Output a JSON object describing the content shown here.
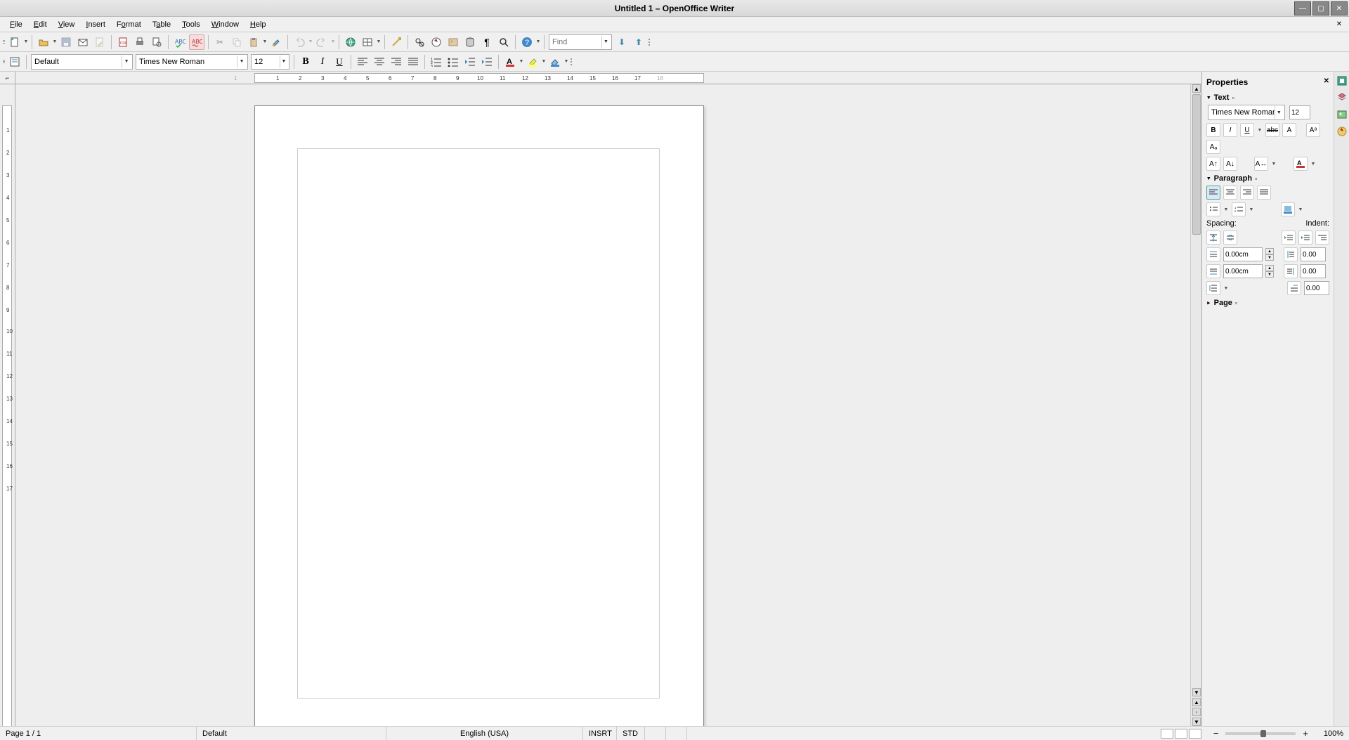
{
  "title": "Untitled 1 – OpenOffice Writer",
  "menu": {
    "items": [
      "File",
      "Edit",
      "View",
      "Insert",
      "Format",
      "Table",
      "Tools",
      "Window",
      "Help"
    ]
  },
  "toolbar_standard": {
    "find_placeholder": "Find"
  },
  "toolbar_format": {
    "style": "Default",
    "font": "Times New Roman",
    "size": "12"
  },
  "ruler": {
    "h_labels": [
      "1",
      "1",
      "2",
      "3",
      "4",
      "5",
      "6",
      "7",
      "8",
      "9",
      "10",
      "11",
      "12",
      "13",
      "14",
      "15",
      "16",
      "17",
      "18"
    ],
    "v_labels": [
      "1",
      "2",
      "3",
      "4",
      "5",
      "6",
      "7",
      "8",
      "9",
      "10",
      "11",
      "12",
      "13",
      "14",
      "15",
      "16",
      "17"
    ]
  },
  "sidebar": {
    "title": "Properties",
    "text": {
      "label": "Text",
      "font": "Times New Roman",
      "size": "12"
    },
    "paragraph": {
      "label": "Paragraph",
      "spacing_label": "Spacing:",
      "indent_label": "Indent:",
      "space_above": "0.00cm",
      "space_below": "0.00cm",
      "indent_left": "0.00",
      "indent_right": "0.00",
      "indent_first": "0.00"
    },
    "page": {
      "label": "Page"
    }
  },
  "status": {
    "page": "Page 1 / 1",
    "style": "Default",
    "lang": "English (USA)",
    "insert": "INSRT",
    "sel": "STD",
    "zoom": "100%"
  }
}
